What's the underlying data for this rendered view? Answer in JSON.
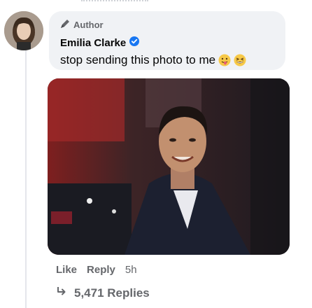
{
  "comment": {
    "author_badge": "Author",
    "name": "Emilia Clarke",
    "text": "stop sending this photo to me",
    "emojis": [
      "face-with-tongue-emoji",
      "grinning-squinting-emoji"
    ]
  },
  "actions": {
    "like": "Like",
    "reply": "Reply",
    "time": "5h"
  },
  "replies": {
    "label": "5,471 Replies"
  },
  "colors": {
    "bubble": "#f0f2f5",
    "verified": "#1877f2",
    "secondary_text": "#65676b",
    "primary_text": "#050505"
  },
  "icons": [
    "pen-icon",
    "verified-badge-icon",
    "reply-arrow-icon"
  ]
}
